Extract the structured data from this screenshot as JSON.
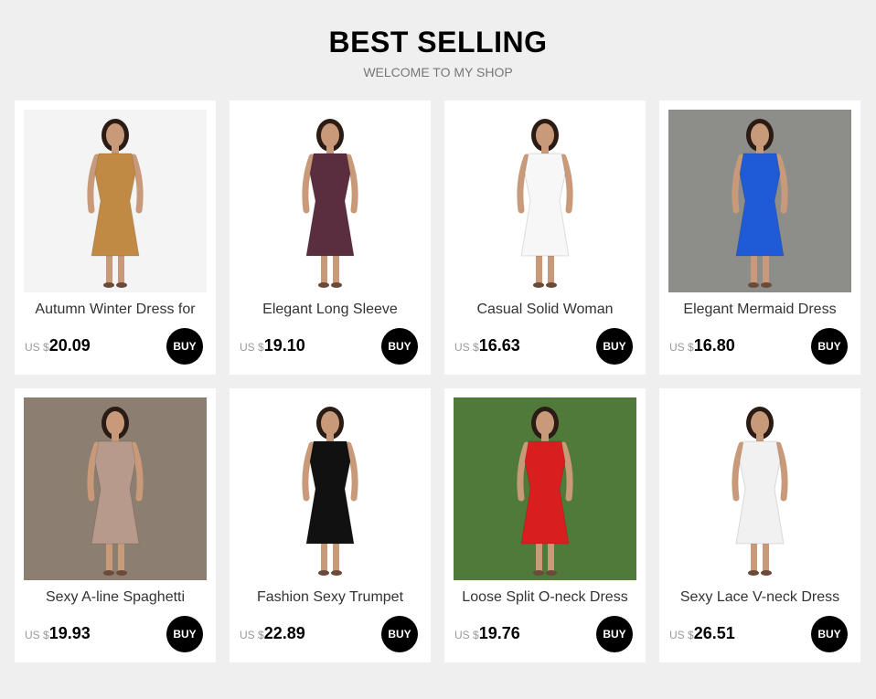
{
  "header": {
    "title": "BEST SELLING",
    "subtitle": "WELCOME TO MY SHOP"
  },
  "currency_label": "US $",
  "buy_label": "BUY",
  "products": [
    {
      "name": "Autumn Winter Dress for",
      "price": "20.09",
      "dress_color": "#c08a45",
      "bg": "#f4f4f4"
    },
    {
      "name": "Elegant Long Sleeve",
      "price": "19.10",
      "dress_color": "#5a2d3f",
      "bg": "#ffffff"
    },
    {
      "name": "Casual Solid Woman",
      "price": "16.63",
      "dress_color": "#f7f7f7",
      "bg": "#ffffff"
    },
    {
      "name": "Elegant Mermaid Dress",
      "price": "16.80",
      "dress_color": "#1f5bd6",
      "bg": "#8d8d8a"
    },
    {
      "name": "Sexy A-line Spaghetti",
      "price": "19.93",
      "dress_color": "#b89a8c",
      "bg": "#8c7e70"
    },
    {
      "name": "Fashion Sexy Trumpet",
      "price": "22.89",
      "dress_color": "#111111",
      "bg": "#ffffff"
    },
    {
      "name": "Loose Split O-neck Dress",
      "price": "19.76",
      "dress_color": "#d81e1e",
      "bg": "#4f7a3a"
    },
    {
      "name": "Sexy Lace V-neck Dress",
      "price": "26.51",
      "dress_color": "#f1f1f1",
      "bg": "#ffffff"
    }
  ]
}
